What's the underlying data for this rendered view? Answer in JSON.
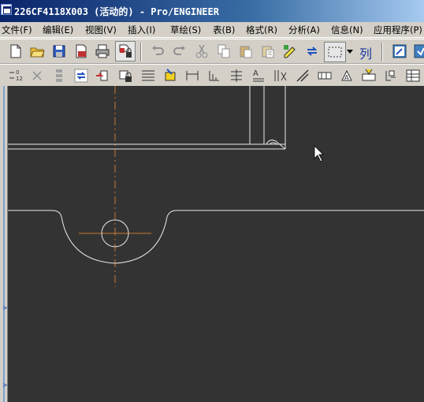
{
  "window": {
    "title": "226CF4118X003 (活动的) - Pro/ENGINEER",
    "app_icon": "pro-engineer-icon"
  },
  "menu": [
    {
      "label": "文件(F)"
    },
    {
      "label": "编辑(E)"
    },
    {
      "label": "视图(V)"
    },
    {
      "label": "插入(I)"
    },
    {
      "label": "草绘(S)"
    },
    {
      "label": "表(B)"
    },
    {
      "label": "格式(R)"
    },
    {
      "label": "分析(A)"
    },
    {
      "label": "信息(N)"
    },
    {
      "label": "应用程序(P)"
    }
  ],
  "toolbar1": {
    "column_label": "列",
    "icons": [
      "new-file-icon",
      "open-folder-icon",
      "save-icon",
      "print-preview-icon",
      "print-icon",
      "drawing-lock-icon",
      "undo-icon",
      "redo-icon",
      "cut-icon",
      "copy-icon",
      "paste-icon",
      "paste-special-icon",
      "regenerate-icon",
      "refresh-icon",
      "select-box-icon",
      "dropdown-icon",
      "column-icon",
      "repaint-icon",
      "help-icon"
    ]
  },
  "toolbar2": {
    "icons": [
      "dimension-icon",
      "delete-icon",
      "stack-icon",
      "replace-icon",
      "move-view-icon",
      "lock-view-icon",
      "table-icon",
      "hatch-icon",
      "linear-dimension-icon",
      "ordinate-icon",
      "baseline-icon",
      "note-icon",
      "leader-icon",
      "symbol-icon",
      "datum-icon",
      "surface-finish-icon",
      "gtol-icon",
      "balloon-icon",
      "table-insert-icon"
    ]
  },
  "colors": {
    "background": "#333333",
    "geometry": "#e8e8e8",
    "centerline": "#c87832"
  }
}
